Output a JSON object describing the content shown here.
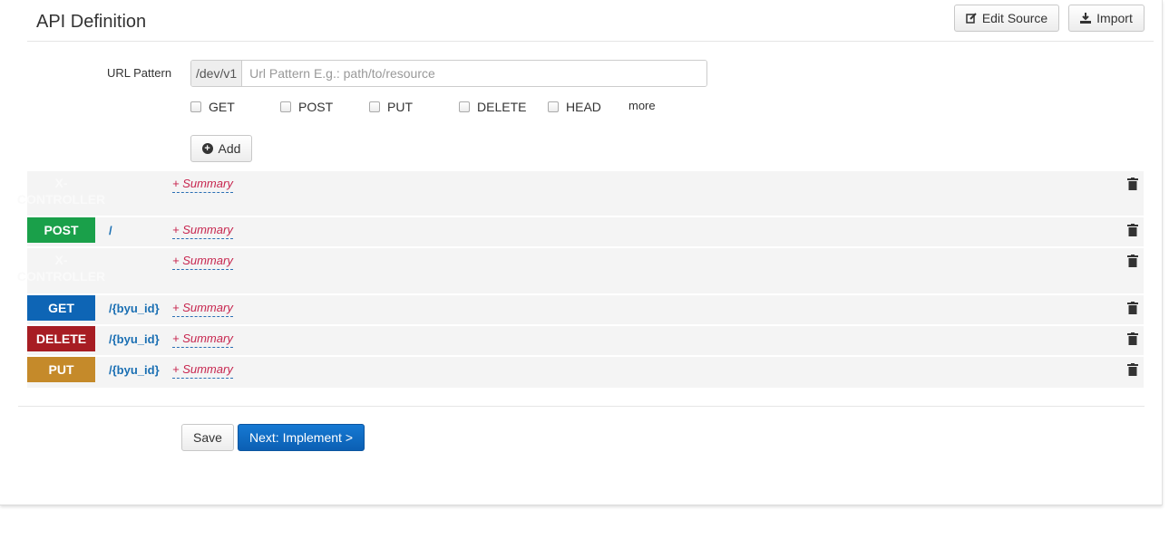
{
  "header": {
    "title": "API Definition",
    "edit_source_label": "Edit Source",
    "import_label": "Import"
  },
  "url_form": {
    "label": "URL Pattern",
    "prefix": "/dev/v1",
    "placeholder": "Url Pattern E.g.: path/to/resource",
    "value": "",
    "methods": [
      "GET",
      "POST",
      "PUT",
      "DELETE",
      "HEAD"
    ],
    "more_label": "more",
    "add_label": "Add"
  },
  "operations": [
    {
      "method": "X-CONTROLLER",
      "path": "",
      "summary": "+ Summary"
    },
    {
      "method": "POST",
      "path": "/",
      "summary": "+ Summary",
      "color": "#1aa04a"
    },
    {
      "method": "X-CONTROLLER",
      "path": "",
      "summary": "+ Summary"
    },
    {
      "method": "GET",
      "path": "/{byu_id}",
      "summary": "+ Summary",
      "color": "#0e65b5"
    },
    {
      "method": "DELETE",
      "path": "/{byu_id}",
      "summary": "+ Summary",
      "color": "#a71d23"
    },
    {
      "method": "PUT",
      "path": "/{byu_id}",
      "summary": "+ Summary",
      "color": "#c58a2a"
    }
  ],
  "footer": {
    "save_label": "Save",
    "next_label": "Next: Implement >"
  },
  "colors": {
    "accent": "#0b6fc9",
    "summary": "#c7254e",
    "path": "#1a6fb3"
  },
  "icons": [
    "edit-icon",
    "download-icon",
    "plus-circle-icon",
    "trash-icon"
  ]
}
